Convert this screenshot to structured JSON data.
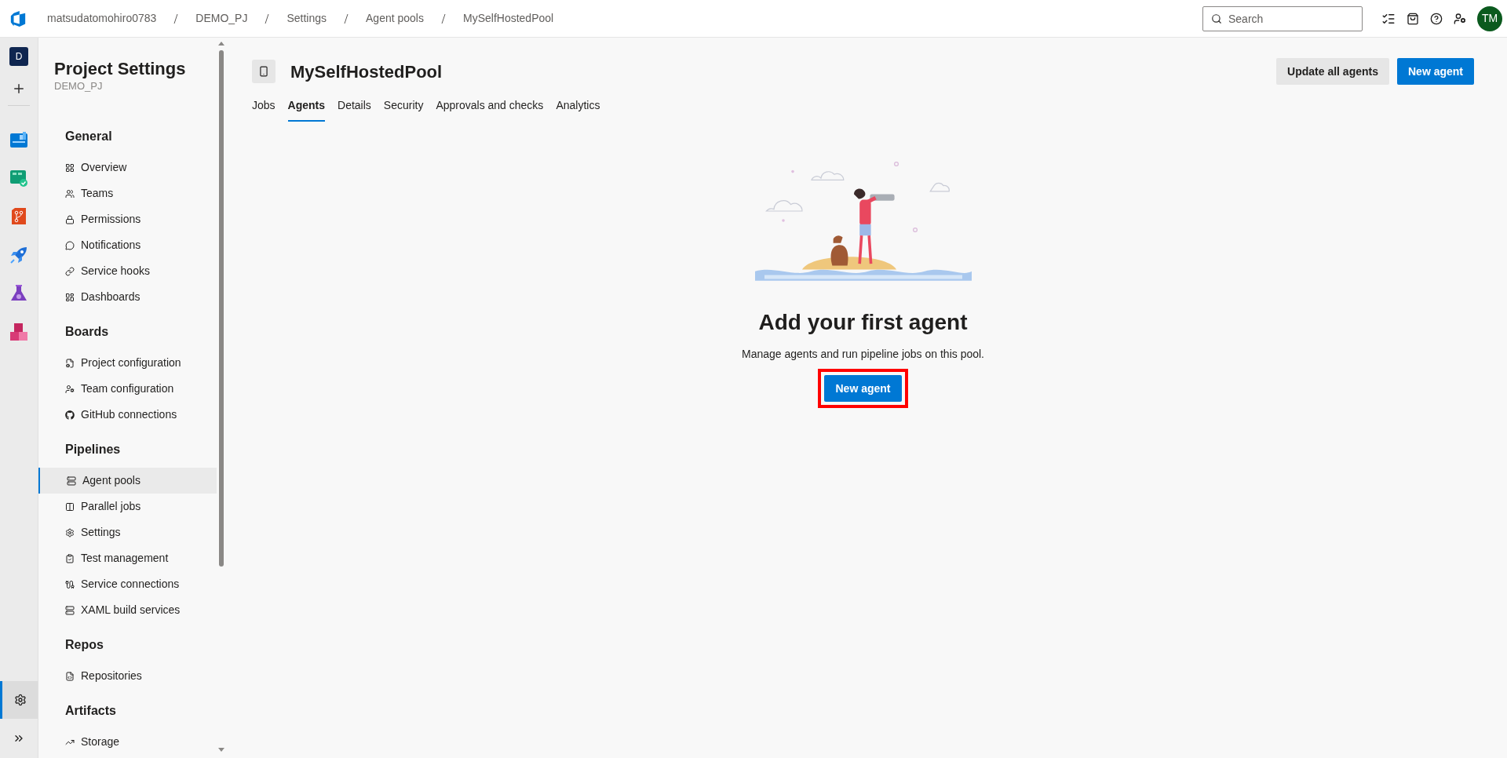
{
  "top_bar": {
    "breadcrumbs": [
      "matsudatomohiro0783",
      "DEMO_PJ",
      "Settings",
      "Agent pools",
      "MySelfHostedPool"
    ],
    "search": {
      "placeholder": "Search"
    },
    "avatar": {
      "initials": "TM"
    }
  },
  "rail": {
    "org_initial": "D",
    "apps": [
      {
        "kind": "boards",
        "selected": false
      },
      {
        "kind": "board-check",
        "selected": false
      },
      {
        "kind": "repos",
        "selected": false
      },
      {
        "kind": "pipelines",
        "selected": false
      },
      {
        "kind": "test-plans",
        "selected": false
      },
      {
        "kind": "artifacts",
        "selected": false
      }
    ],
    "settings_selected": true
  },
  "sidebar": {
    "title": "Project Settings",
    "subtitle": "DEMO_PJ",
    "sections": [
      {
        "heading": "General",
        "items": [
          {
            "label": "Overview",
            "kind": "overview",
            "selected": false
          },
          {
            "label": "Teams",
            "kind": "teams",
            "selected": false
          },
          {
            "label": "Permissions",
            "kind": "lock",
            "selected": false
          },
          {
            "label": "Notifications",
            "kind": "notifications",
            "selected": false
          },
          {
            "label": "Service hooks",
            "kind": "hooks",
            "selected": false
          },
          {
            "label": "Dashboards",
            "kind": "dashboards",
            "selected": false
          }
        ]
      },
      {
        "heading": "Boards",
        "items": [
          {
            "label": "Project configuration",
            "kind": "project-config",
            "selected": false
          },
          {
            "label": "Team configuration",
            "kind": "team-config",
            "selected": false
          },
          {
            "label": "GitHub connections",
            "kind": "github",
            "selected": false
          }
        ]
      },
      {
        "heading": "Pipelines",
        "items": [
          {
            "label": "Agent pools",
            "kind": "server",
            "selected": true
          },
          {
            "label": "Parallel jobs",
            "kind": "parallel",
            "selected": false
          },
          {
            "label": "Settings",
            "kind": "gear",
            "selected": false
          },
          {
            "label": "Test management",
            "kind": "test",
            "selected": false
          },
          {
            "label": "Service connections",
            "kind": "connections",
            "selected": false
          },
          {
            "label": "XAML build services",
            "kind": "server",
            "selected": false
          }
        ]
      },
      {
        "heading": "Repos",
        "items": [
          {
            "label": "Repositories",
            "kind": "repo",
            "selected": false
          }
        ]
      },
      {
        "heading": "Artifacts",
        "items": [
          {
            "label": "Storage",
            "kind": "storage",
            "selected": false
          }
        ]
      }
    ]
  },
  "pool": {
    "name": "MySelfHostedPool",
    "buttons": [
      {
        "label": "Update all agents",
        "kind": "secondary"
      },
      {
        "label": "New agent",
        "kind": "primary"
      }
    ],
    "tabs": [
      {
        "label": "Jobs",
        "selected": false
      },
      {
        "label": "Agents",
        "selected": true
      },
      {
        "label": "Details",
        "selected": false
      },
      {
        "label": "Security",
        "selected": false
      },
      {
        "label": "Approvals and checks",
        "selected": false
      },
      {
        "label": "Analytics",
        "selected": false
      }
    ]
  },
  "empty_state": {
    "heading": "Add your first agent",
    "message": "Manage agents and run pipeline jobs on this pool.",
    "button": {
      "label": "New agent",
      "highlighted": true
    }
  }
}
